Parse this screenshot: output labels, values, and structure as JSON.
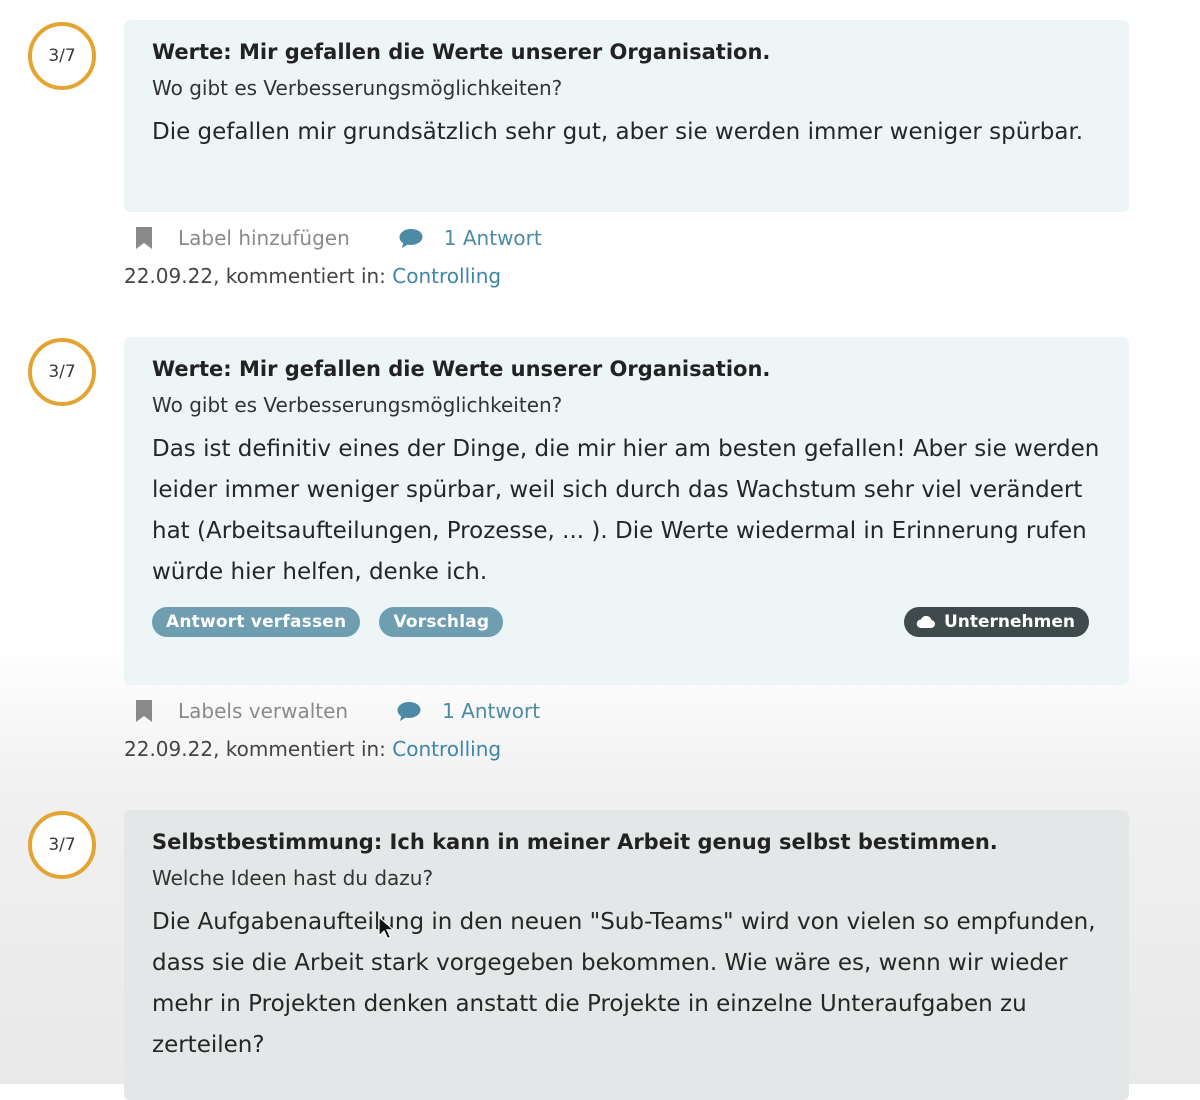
{
  "entries": [
    {
      "score": "3/7",
      "question": "Werte: Mir gefallen die Werte unserer Organisation.",
      "prompt": "Wo gibt es Verbesserungsmöglichkeiten?",
      "answer": "Die gefallen mir grundsätzlich sehr gut, aber sie werden immer weniger spürbar.",
      "label_action": "Label hinzufügen",
      "replies": "1 Antwort",
      "date_prefix": "22.09.22, kommentiert in: ",
      "area": "Controlling"
    },
    {
      "score": "3/7",
      "question": "Werte: Mir gefallen die Werte unserer Organisation.",
      "prompt": "Wo gibt es Verbesserungsmöglichkeiten?",
      "answer": "Das ist definitiv eines der Dinge, die mir hier am besten gefallen! Aber sie werden leider immer weniger spürbar, weil sich durch das Wachstum sehr viel verändert hat (Arbeitsaufteilungen, Prozesse, ... ). Die Werte wiedermal in Erinnerung rufen würde hier helfen, denke ich.",
      "tag_reply": "Antwort verfassen",
      "tag_suggestion": "Vorschlag",
      "scope": "Unternehmen",
      "label_action": "Labels verwalten",
      "replies": "1 Antwort",
      "date_prefix": "22.09.22, kommentiert in: ",
      "area": "Controlling"
    },
    {
      "score": "3/7",
      "question": "Selbstbestimmung: Ich kann in meiner Arbeit genug selbst bestimmen.",
      "prompt": "Welche Ideen hast du dazu?",
      "answer": "Die Aufgabenaufteilung in den neuen \"Sub-Teams\" wird von vielen so empfunden, dass sie die Arbeit stark vorgegeben bekommen. Wie wäre es, wenn wir wieder mehr in Projekten denken anstatt die Projekte in einzelne Unteraufgaben zu zerteilen?"
    }
  ],
  "colors": {
    "score_ring": "#e3a432",
    "card_bg": "#eef5f6",
    "tag_bg": "#6e9eb0",
    "scope_bg": "#3f4a4c",
    "link": "#3f85a8"
  }
}
